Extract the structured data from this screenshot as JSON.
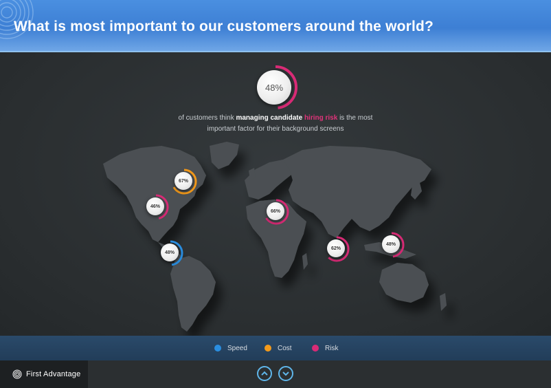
{
  "header": {
    "title": "What is most important to our customers around the world?"
  },
  "hero": {
    "percent": "48%",
    "text_before": "of customers think ",
    "text_bold": "managing candidate",
    "text_space": " ",
    "text_highlight": "hiring risk",
    "text_after": " is the most",
    "text_line2": "important factor for their background screens"
  },
  "map": {
    "badges": [
      {
        "label": "67%",
        "category": "Cost",
        "color": "#f39a1b",
        "value": 67
      },
      {
        "label": "46%",
        "category": "Risk",
        "color": "#d92b76",
        "value": 46
      },
      {
        "label": "48%",
        "category": "Speed",
        "color": "#2a8ee0",
        "value": 48
      },
      {
        "label": "66%",
        "category": "Risk",
        "color": "#d92b76",
        "value": 66
      },
      {
        "label": "62%",
        "category": "Risk",
        "color": "#d92b76",
        "value": 62
      },
      {
        "label": "48%",
        "category": "Risk",
        "color": "#d92b76",
        "value": 48
      }
    ]
  },
  "legend": {
    "speed": {
      "label": "Speed",
      "color": "#2a8ee0"
    },
    "cost": {
      "label": "Cost",
      "color": "#f39a1b"
    },
    "risk": {
      "label": "Risk",
      "color": "#d92b76"
    }
  },
  "footer": {
    "logo_text": "First Advantage",
    "nav_up_icon": "chevron-up-icon",
    "nav_down_icon": "chevron-down-icon"
  },
  "colors": {
    "accent_blue": "#3d7fd4",
    "nav": "#5fb6ea"
  }
}
